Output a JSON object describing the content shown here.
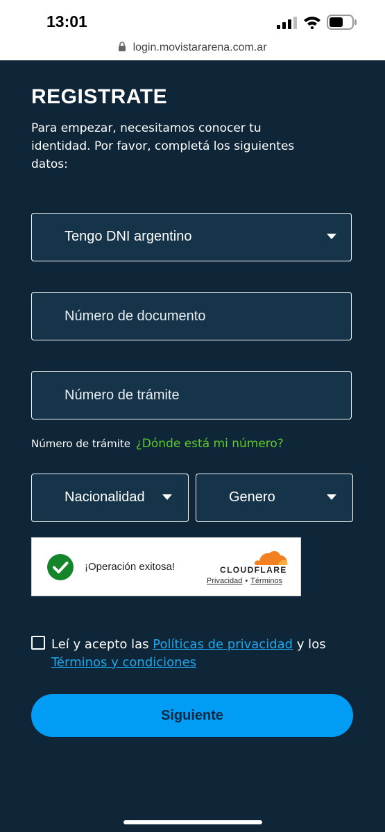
{
  "status_bar": {
    "time": "13:01"
  },
  "browser": {
    "url": "login.movistararena.com.ar"
  },
  "page": {
    "title": "REGISTRATE",
    "intro": "Para empezar, necesitamos conocer tu identidad. Por favor, completá los siguientes datos:"
  },
  "form": {
    "doc_type": {
      "selected": "Tengo DNI argentino"
    },
    "doc_number": {
      "placeholder": "Número de documento"
    },
    "tramite_number": {
      "placeholder": "Número de trámite"
    },
    "help": {
      "label": "Número de trámite",
      "link": "¿Dónde está mi número?"
    },
    "nationality": {
      "selected": "Nacionalidad"
    },
    "gender": {
      "selected": "Genero"
    }
  },
  "captcha": {
    "status": "¡Operación exitosa!",
    "brand": "CLOUDFLARE",
    "privacy": "Privacidad",
    "separator": "•",
    "terms": "Términos"
  },
  "consent": {
    "prefix": "Leí y acepto las",
    "privacy_link": "Políticas de privacidad",
    "middle": "y los",
    "terms_link": "Términos y condiciones",
    "checked": false
  },
  "submit": {
    "label": "Siguiente"
  },
  "colors": {
    "background": "#0f2638",
    "field_background": "#163449",
    "accent_green": "#5ecb2a",
    "link_blue": "#1ea7ec",
    "button_blue": "#019df4",
    "cloudflare_orange": "#f38020",
    "success_green": "#14852b"
  },
  "icons": {
    "signal": "cellular-signal-icon",
    "wifi": "wifi-icon",
    "battery": "battery-icon",
    "lock": "lock-icon",
    "caret": "caret-down-icon",
    "check": "check-circle-icon",
    "cloud": "cloudflare-cloud-icon"
  }
}
